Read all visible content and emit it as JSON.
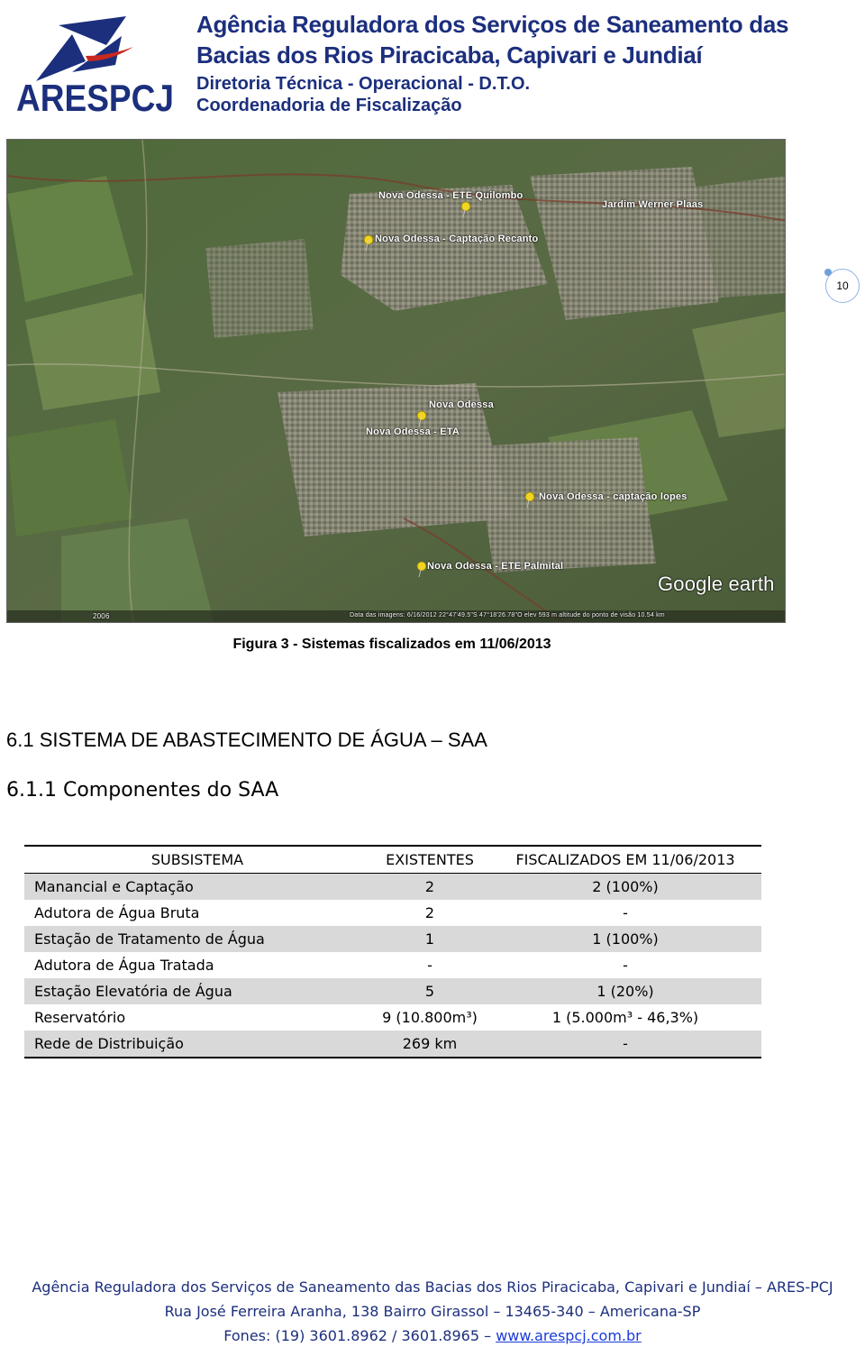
{
  "header": {
    "logo_text": "ARESPCJ",
    "line1": "Agência Reguladora dos Serviços de Saneamento das",
    "line2": "Bacias dos Rios Piracicaba, Capivari e Jundiaí",
    "line3": "Diretoria Técnica - Operacional - D.T.O.",
    "line4": "Coordenadoria de Fiscalização"
  },
  "page_number": "10",
  "map": {
    "labels": [
      "Nova Odessa - ETE Quilombo",
      "Nova Odessa - Captação Recanto",
      "Nova Odessa - ETA",
      "Nova Odessa - captação lopes",
      "Nova Odessa - ETE Palmital",
      "Nova Odessa",
      "Jardim Werner Plaas"
    ],
    "brand": "Google earth",
    "status_bar": "Data das imagens: 6/16/2012   22°47'49.5\"S   47°18'26.78\"O   elev  593 m     altitude do ponto de visão  10.54 km",
    "year": "2006"
  },
  "caption": "Figura 3 - Sistemas fiscalizados em 11/06/2013",
  "section_title": "6.1 SISTEMA DE ABASTECIMENTO DE ÁGUA – SAA",
  "subsection_title": "6.1.1 Componentes do SAA",
  "table": {
    "headers": [
      "SUBSISTEMA",
      "EXISTENTES",
      "FISCALIZADOS EM 11/06/2013"
    ],
    "rows": [
      [
        "Manancial e Captação",
        "2",
        "2 (100%)"
      ],
      [
        "Adutora de Água Bruta",
        "2",
        "-"
      ],
      [
        "Estação de Tratamento de Água",
        "1",
        "1 (100%)"
      ],
      [
        "Adutora de Água Tratada",
        "-",
        "-"
      ],
      [
        "Estação Elevatória de Água",
        "5",
        "1 (20%)"
      ],
      [
        "Reservatório",
        "9 (10.800m³)",
        "1 (5.000m³ - 46,3%)"
      ],
      [
        "Rede de Distribuição",
        "269 km",
        "-"
      ]
    ]
  },
  "footer": {
    "line1": "Agência Reguladora dos Serviços de Saneamento das Bacias dos Rios Piracicaba, Capivari e Jundiaí – ARES-PCJ",
    "line2": "Rua José Ferreira Aranha, 138 Bairro Girassol – 13465-340 – Americana-SP",
    "phones": "Fones: (19) 3601.8962 / 3601.8965 – ",
    "website": "www.arespcj.com.br"
  },
  "colors": {
    "brand_blue": "#1c2f7d",
    "logo_red": "#c9281f",
    "table_shade": "#d9d9d9",
    "link": "#1a3bd8"
  }
}
